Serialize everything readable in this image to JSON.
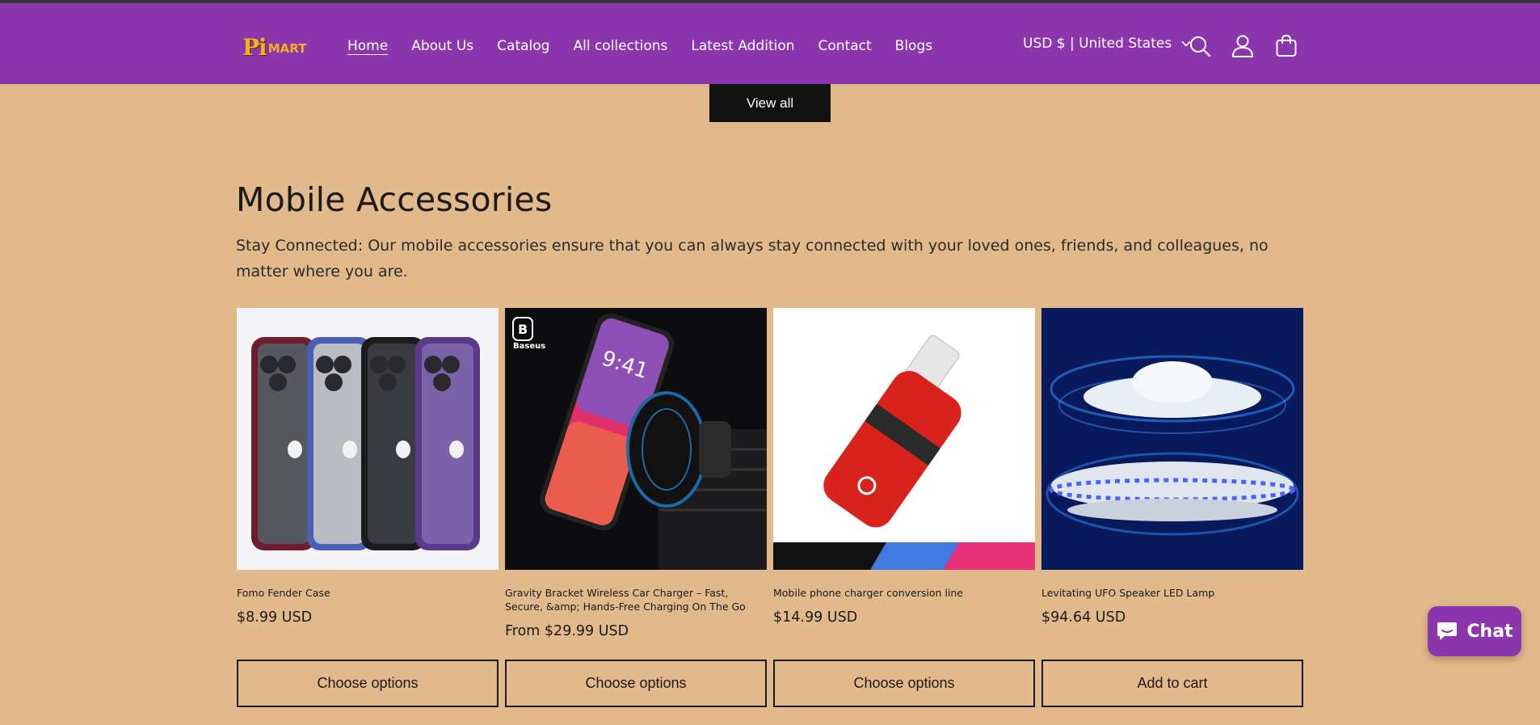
{
  "brand": {
    "logo_pi": "Pi",
    "logo_mart": "MART"
  },
  "nav": {
    "items": [
      {
        "label": "Home",
        "active": true
      },
      {
        "label": "About Us"
      },
      {
        "label": "Catalog"
      },
      {
        "label": "All collections"
      },
      {
        "label": "Latest Addition"
      },
      {
        "label": "Contact"
      },
      {
        "label": "Blogs"
      }
    ]
  },
  "header": {
    "currency": "USD $ | United States",
    "icons": [
      "search-icon",
      "account-icon",
      "cart-icon"
    ]
  },
  "view_all_label": "View all",
  "section": {
    "title": "Mobile Accessories",
    "description": "Stay Connected: Our mobile accessories ensure that you can always stay connected with your loved ones, friends, and colleagues, no matter where you are."
  },
  "products": [
    {
      "title": "Fomo Fender Case",
      "price": "$8.99 USD",
      "cta": "Choose options"
    },
    {
      "title": "Gravity Bracket Wireless Car Charger – Fast, Secure, &amp; Hands-Free Charging On The Go",
      "price": "From $29.99 USD",
      "cta": "Choose options",
      "image_brand": "Baseus",
      "image_time": "9:41"
    },
    {
      "title": "Mobile phone charger conversion line",
      "price": "$14.99 USD",
      "cta": "Choose options"
    },
    {
      "title": "Levitating UFO Speaker LED Lamp",
      "price": "$94.64 USD",
      "cta": "Add to cart"
    }
  ],
  "chat_label": "Chat",
  "colors": {
    "header": "#8b36ac",
    "background": "#e2b98a",
    "button_dark": "#111111"
  }
}
